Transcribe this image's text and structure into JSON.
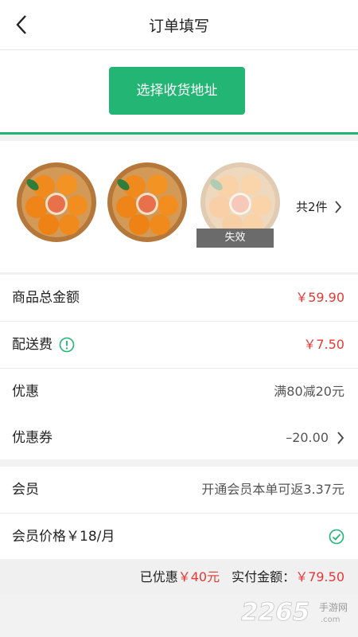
{
  "header": {
    "title": "订单填写",
    "back_icon": "chevron-left-icon"
  },
  "address": {
    "button_label": "选择收货地址"
  },
  "goods": {
    "items": [
      {
        "name": "orange-basket",
        "status": ""
      },
      {
        "name": "orange-basket",
        "status": ""
      },
      {
        "name": "orange-basket",
        "status": "失效"
      }
    ],
    "count_label": "共2件"
  },
  "summary": {
    "total_label": "商品总金额",
    "total_value": "￥59.90",
    "shipping_label": "配送费",
    "shipping_value": "￥7.50",
    "discount_label": "优惠",
    "discount_value": "满80减20元",
    "coupon_label": "优惠券",
    "coupon_value": "–20.00"
  },
  "member": {
    "label": "会员",
    "value": "开通会员本单可返3.37元",
    "price_label": "会员价格￥18/月"
  },
  "footer": {
    "saved_label": "已优惠",
    "saved_value": "￥40元",
    "pay_label": "实付金额：",
    "pay_value": "￥79.50"
  },
  "watermark": {
    "number": "2265",
    "suffix": "手游网",
    "domain": ".com"
  },
  "colors": {
    "accent": "#22b573",
    "price": "#e53935"
  }
}
